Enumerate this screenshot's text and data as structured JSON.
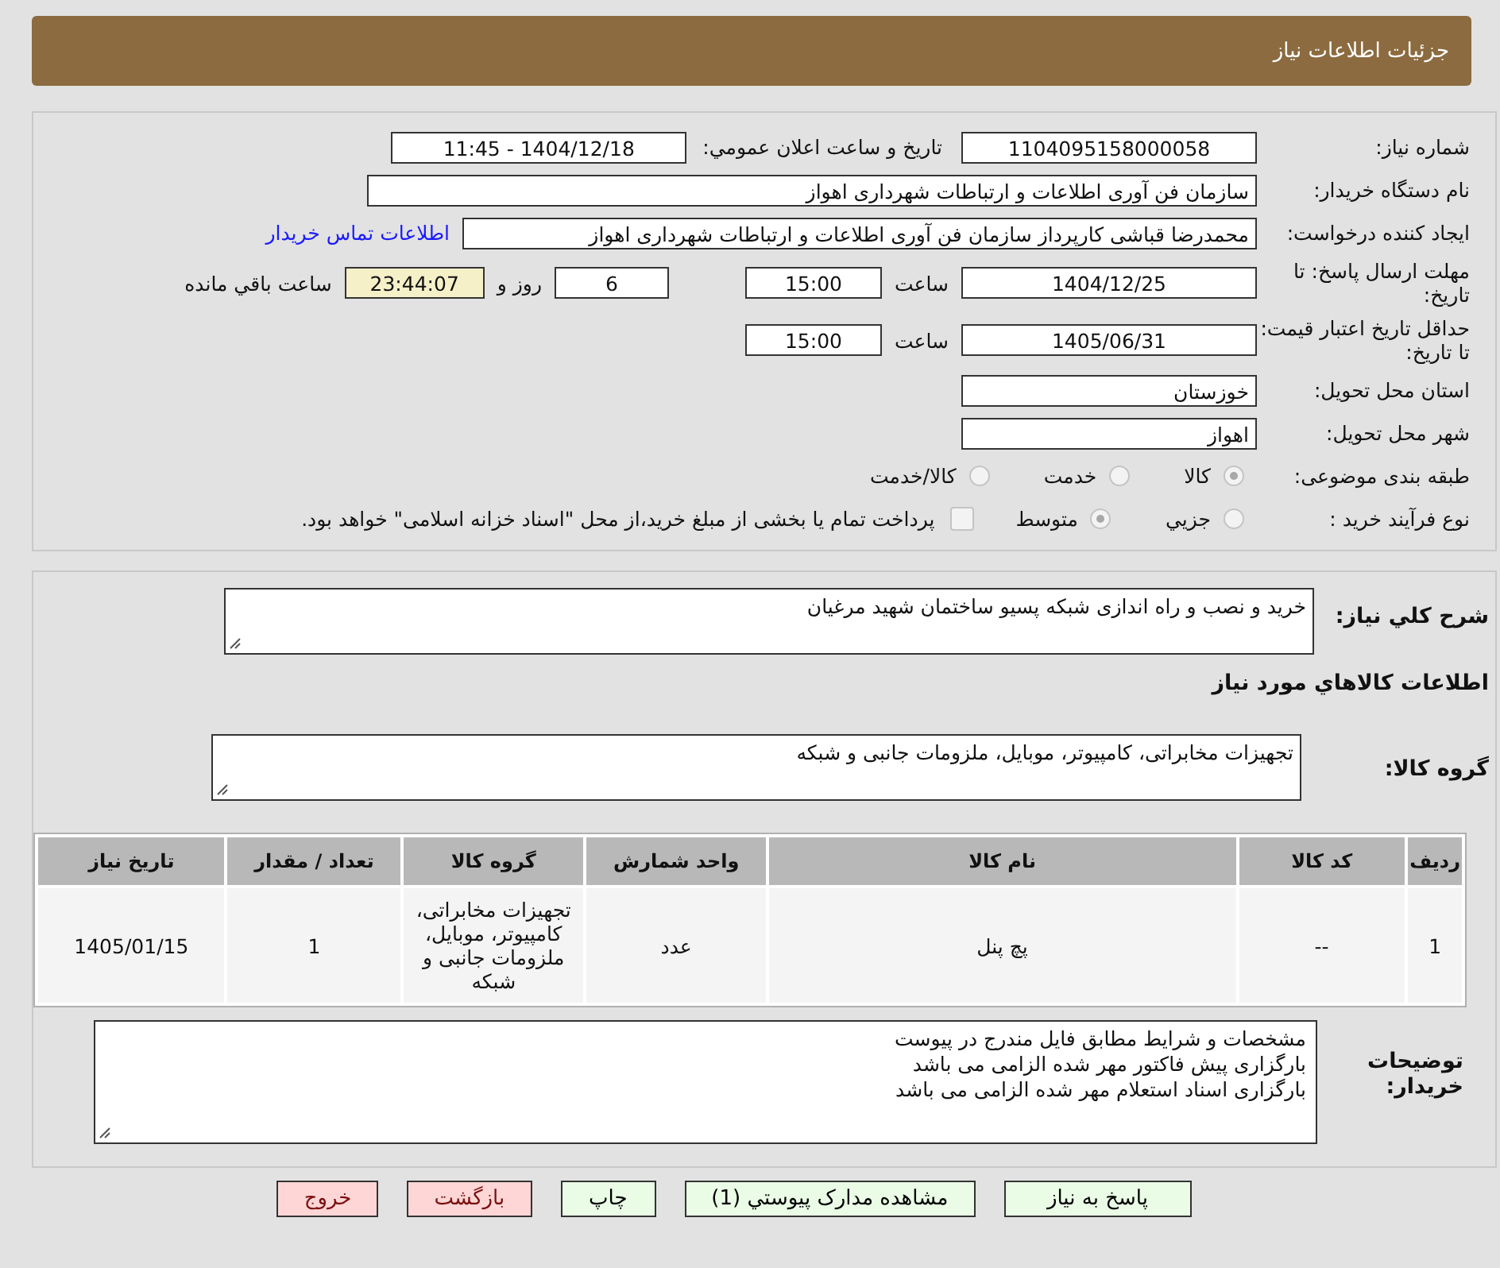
{
  "header": {
    "title": "جزئیات اطلاعات نیاز"
  },
  "need_number": {
    "label": "شماره نیاز:",
    "value": "1104095158000058"
  },
  "announce": {
    "label": "تاريخ و ساعت اعلان عمومي:",
    "value": "1404/12/18 - 11:45"
  },
  "buyer_org": {
    "label": "نام دستگاه خریدار:",
    "value": "سازمان فن آوری اطلاعات و ارتباطات شهرداری اهواز"
  },
  "requester": {
    "label": "ایجاد کننده درخواست:",
    "value": "محمدرضا قباشی کارپرداز سازمان فن آوری اطلاعات و ارتباطات شهرداری اهواز",
    "link": "اطلاعات تماس خریدار"
  },
  "deadline": {
    "label": "مهلت ارسال پاسخ: تا تاریخ:",
    "date": "1404/12/25",
    "time_label": "ساعت",
    "time": "15:00",
    "days": "6",
    "days_label": "روز و",
    "remaining": "23:44:07",
    "remaining_label": "ساعت باقي مانده"
  },
  "validity": {
    "label": "حداقل تاریخ اعتبار قیمت: تا تاریخ:",
    "date": "1405/06/31",
    "time_label": "ساعت",
    "time": "15:00"
  },
  "province": {
    "label": "استان محل تحویل:",
    "value": "خوزستان"
  },
  "city": {
    "label": "شهر محل تحویل:",
    "value": "اهواز"
  },
  "category": {
    "label": "طبقه بندی موضوعی:",
    "options": [
      {
        "label": "کالا",
        "selected": true
      },
      {
        "label": "خدمت",
        "selected": false
      },
      {
        "label": "کالا/خدمت",
        "selected": false
      }
    ]
  },
  "process": {
    "label": "نوع فرآیند خرید :",
    "options": [
      {
        "label": "جزيي",
        "selected": false
      },
      {
        "label": "متوسط",
        "selected": true
      }
    ],
    "payment": {
      "label": "پرداخت تمام یا بخشی از مبلغ خرید،از محل \"اسناد خزانه اسلامی\" خواهد بود.",
      "checked": false
    }
  },
  "description": {
    "label": "شرح کلي نیاز:",
    "value": "خرید و نصب و راه اندازی شبکه پسیو ساختمان شهید مرغیان"
  },
  "goods_heading": "اطلاعات کالاهاي مورد نیاز",
  "goods_group": {
    "label": "گروه کالا:",
    "value": "تجهیزات مخابراتی، کامپیوتر، موبایل، ملزومات جانبی و شبکه"
  },
  "table": {
    "columns": [
      "ردیف",
      "کد کالا",
      "نام کالا",
      "واحد شمارش",
      "گروه کالا",
      "تعداد / مقدار",
      "تاریخ نیاز"
    ],
    "rows": [
      [
        "1",
        "--",
        "پچ پنل",
        "عدد",
        "تجهیزات مخابراتی، کامپیوتر، موبایل، ملزومات جانبی و شبکه",
        "1",
        "1405/01/15"
      ]
    ]
  },
  "buyer_notes": {
    "label": "توضیحات خریدار:",
    "lines": [
      "مشخصات و شرایط مطابق فایل مندرج در پیوست",
      "بارگزاری پیش فاکتور مهر شده الزامی می باشد",
      "بارگزاری اسناد استعلام مهر شده الزامی می باشد"
    ]
  },
  "buttons": [
    {
      "label": "پاسخ به نیاز",
      "kind": "normal"
    },
    {
      "label": "مشاهده مدارک پیوستي (1)",
      "kind": "normal"
    },
    {
      "label": "چاپ",
      "kind": "normal"
    },
    {
      "label": "بازگشت",
      "kind": "danger"
    },
    {
      "label": "خروج",
      "kind": "danger"
    }
  ]
}
